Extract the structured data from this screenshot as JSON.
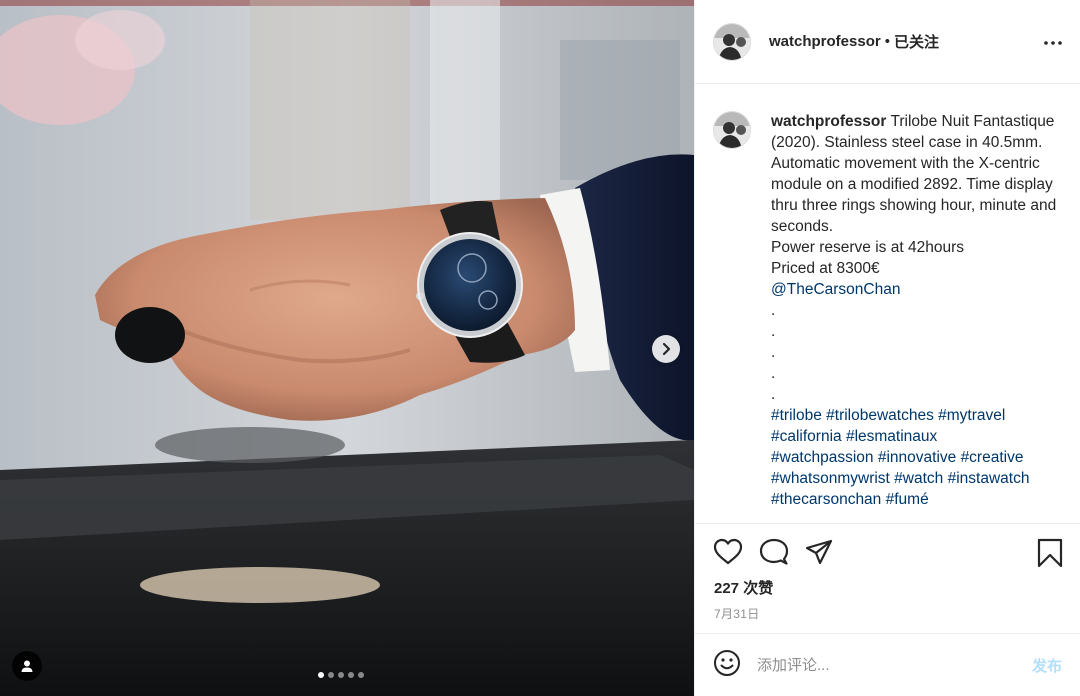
{
  "post": {
    "username": "watchprofessor",
    "separator": "•",
    "follow_status": "已关注",
    "more_icon": "more-horizontal-icon",
    "caption": {
      "username": "watchprofessor",
      "lines": [
        "Trilobe Nuit Fantastique (2020). Stainless steel case in 40.5mm. Automatic movement with the X-centric module on a modified 2892. Time display thru three rings showing hour, minute and seconds.",
        "Power reserve is at 42hours",
        "Priced at 8300€"
      ],
      "mention": "@TheCarsonChan",
      "spacer_dots": [
        ".",
        ".",
        ".",
        ".",
        "."
      ],
      "hashtag_lines": [
        "#trilobe #trilobewatches #mytravel",
        "#california #lesmatinaux",
        "#watchpassion #innovative #creative",
        "#whatsonmywrist #watch #instawatch",
        "#thecarsonchan #fumé"
      ]
    },
    "likes": "227 次赞",
    "date": "7月31日"
  },
  "actions": {
    "like": "heart-icon",
    "comment": "comment-icon",
    "share": "send-icon",
    "save": "bookmark-icon"
  },
  "comment_box": {
    "emoji_icon": "emoji-icon",
    "placeholder": "添加评论...",
    "post_label": "发布"
  },
  "carousel": {
    "slide_count": 5,
    "active_index": 0,
    "next_icon": "chevron-right-icon",
    "tag_icon": "user-tag-icon"
  },
  "colors": {
    "link": "#00376b",
    "post_disabled": "#b2dffc",
    "muted": "#8e8e8e",
    "border": "#efefef"
  }
}
